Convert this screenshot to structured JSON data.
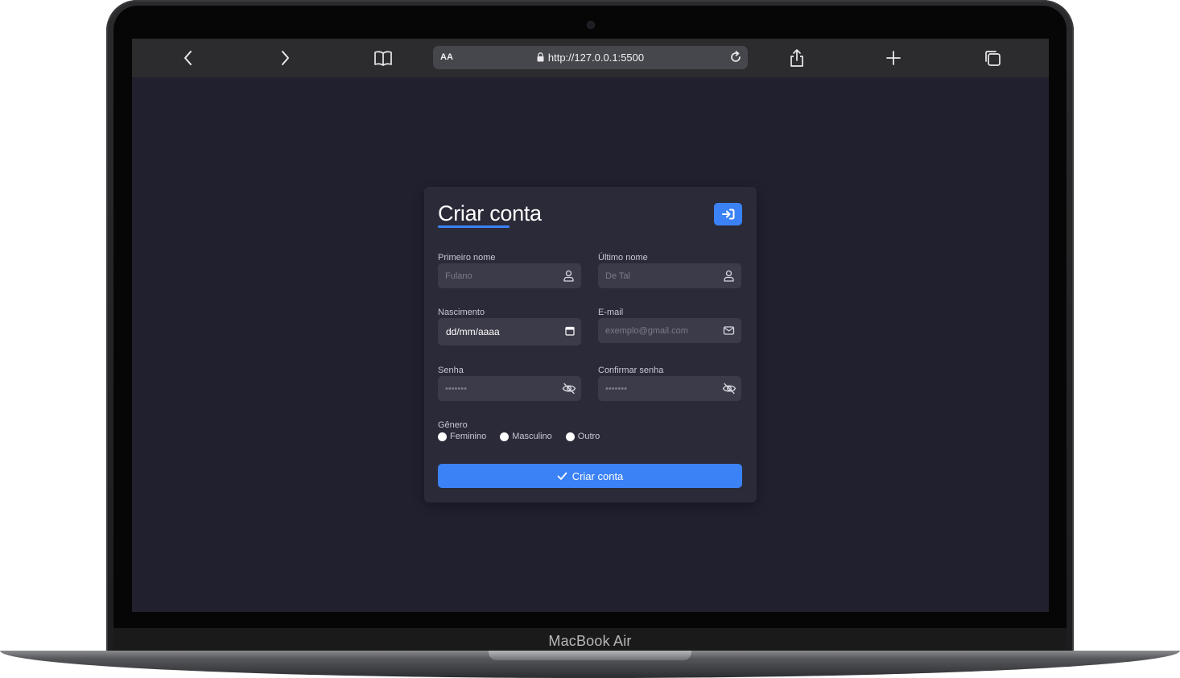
{
  "device": {
    "label": "MacBook Air"
  },
  "browser": {
    "address_prefix": "AA",
    "url": "http://127.0.0.1:5500"
  },
  "form": {
    "title": "Criar conta",
    "first_name": {
      "label": "Primeiro nome",
      "placeholder": "Fulano"
    },
    "last_name": {
      "label": "Último nome",
      "placeholder": "De Tal"
    },
    "birth": {
      "label": "Nascimento",
      "value": "dd/mm/aaaa"
    },
    "email": {
      "label": "E-mail",
      "placeholder": "exemplo@gmail.com"
    },
    "password": {
      "label": "Senha",
      "placeholder": "•••••••"
    },
    "confirm_password": {
      "label": "Confirmar senha",
      "placeholder": "•••••••"
    },
    "gender": {
      "label": "Gênero",
      "options": [
        "Feminino",
        "Masculino",
        "Outro"
      ]
    },
    "submit_label": "Criar conta"
  },
  "colors": {
    "accent": "#3b82f6",
    "background": "#21202f",
    "card": "#2b2a38"
  }
}
